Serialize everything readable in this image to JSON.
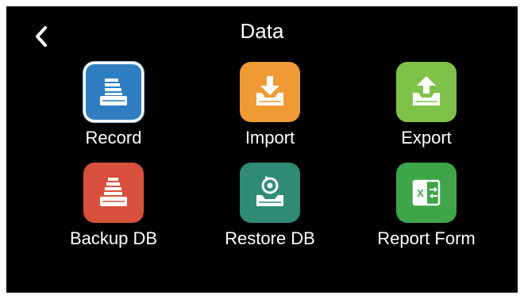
{
  "header": {
    "title": "Data",
    "back_icon": "chevron-left-icon"
  },
  "colors": {
    "background": "#000000",
    "record": "#2f7ec1",
    "import": "#ef9a34",
    "export": "#7ec24a",
    "backup": "#d8513c",
    "restore": "#2f8c73",
    "report": "#3ea548"
  },
  "tiles": [
    {
      "label": "Record",
      "icon": "database-list-icon",
      "selected": true
    },
    {
      "label": "Import",
      "icon": "import-arrow-icon",
      "selected": false
    },
    {
      "label": "Export",
      "icon": "export-arrow-icon",
      "selected": false
    },
    {
      "label": "Backup DB",
      "icon": "backup-database-icon",
      "selected": false
    },
    {
      "label": "Restore DB",
      "icon": "restore-database-icon",
      "selected": false
    },
    {
      "label": "Report Form",
      "icon": "excel-report-icon",
      "selected": false
    }
  ]
}
